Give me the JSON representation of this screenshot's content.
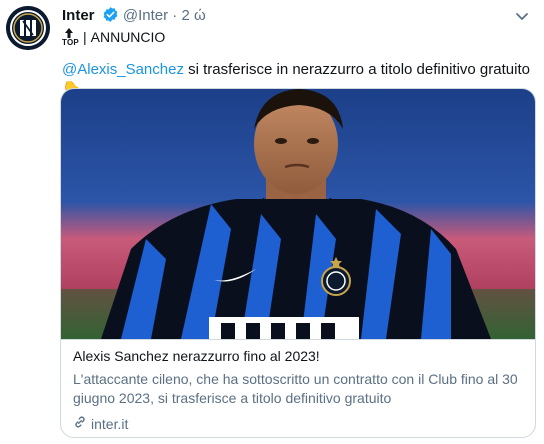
{
  "tweet": {
    "author_name": "Inter",
    "handle": "@Inter",
    "dot": "·",
    "time": "2 ώ",
    "top_label": "TOP",
    "separator": "|",
    "announcement": "ANNUNCIO",
    "mention": "@Alexis_Sanchez",
    "text": " si trasferisce in nerazzurro a titolo definitivo gratuito ",
    "emoji": "👇"
  },
  "card": {
    "title": "Alexis Sanchez nerazzurro fino al 2023!",
    "description": "L'attaccante cileno, che ha sottoscritto un contratto con il Club fino al 30 giugno 2023, si trasferisce a titolo definitivo gratuito",
    "domain": "inter.it"
  },
  "colors": {
    "link": "#1b95e0",
    "secondary_text": "#5b7083",
    "verified": "#1da1f2",
    "inter_blue": "#0068a8"
  }
}
